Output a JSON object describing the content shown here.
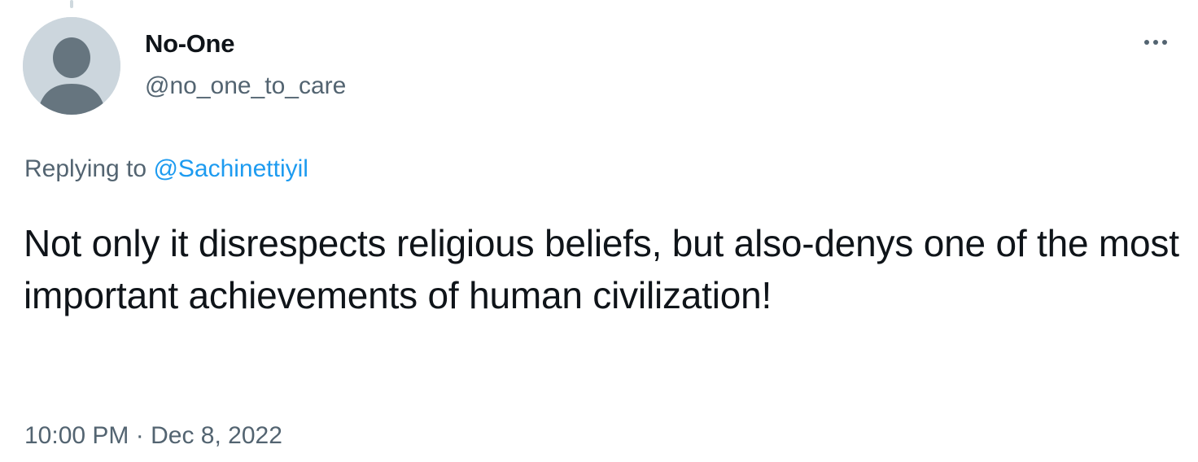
{
  "user": {
    "display_name": "No-One",
    "handle": "@no_one_to_care",
    "avatar_icon": "default-profile-silhouette-icon"
  },
  "menu": {
    "more_icon": "more-horizontal-icon"
  },
  "reply": {
    "prefix": "Replying to",
    "mention": "@Sachinettiyil"
  },
  "tweet": {
    "text": "Not only it disrespects religious beliefs, but also-denys one of the most important achievements of human civilization!",
    "time": "10:00 PM",
    "separator": "·",
    "date": "Dec 8, 2022"
  },
  "colors": {
    "primary_text": "#0f1419",
    "secondary_text": "#536471",
    "link": "#1d9bf0",
    "avatar_bg": "#ccd6dd",
    "avatar_figure": "#66757f"
  }
}
